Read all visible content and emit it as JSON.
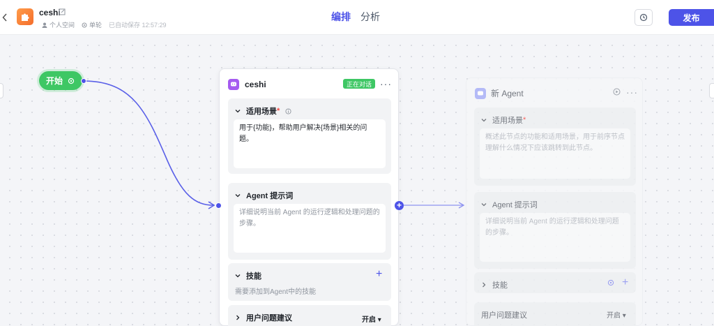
{
  "header": {
    "back_icon": "chevron-left-icon",
    "app_icon": "puzzle-icon",
    "title": "ceshi",
    "space": "个人空间",
    "mode": "单轮",
    "autosave": "已自动保存 12:57:29",
    "tabs": [
      {
        "label": "编排",
        "active": true
      },
      {
        "label": "分析",
        "active": false
      }
    ],
    "history_icon": "history-icon",
    "publish_label": "发布",
    "accent": "#4d53e8"
  },
  "start_node": {
    "label": "开始",
    "icon": "gear-icon",
    "color": "#3ec764"
  },
  "agent_node": {
    "title": "ceshi",
    "status": "正在对话",
    "more": "···",
    "scenario": {
      "label": "适用场景",
      "required": "*",
      "value": "用于{功能}，帮助用户解决{场景}相关的问题。"
    },
    "prompt": {
      "label": "Agent 提示词",
      "placeholder": "详细说明当前 Agent 的运行逻辑和处理问题的步骤。"
    },
    "skills": {
      "label": "技能",
      "hint": "需要添加到Agent中的技能",
      "add": "+"
    },
    "suggestions": {
      "label": "用户问题建议",
      "value": "开启 ▾"
    }
  },
  "ghost_node": {
    "title": "新 Agent",
    "more": "···",
    "scenario": {
      "label": "适用场景",
      "required": "*",
      "placeholder": "概述此节点的功能和适用场景，用于前序节点理解什么情况下应该跳转到此节点。"
    },
    "prompt": {
      "label": "Agent 提示词",
      "placeholder": "详细说明当前 Agent 的运行逻辑和处理问题的步骤。"
    },
    "skills": {
      "label": "技能",
      "add": "+"
    },
    "suggestions": {
      "label": "用户问题建议",
      "value": "开启 ▾"
    }
  },
  "plus_port": "+"
}
